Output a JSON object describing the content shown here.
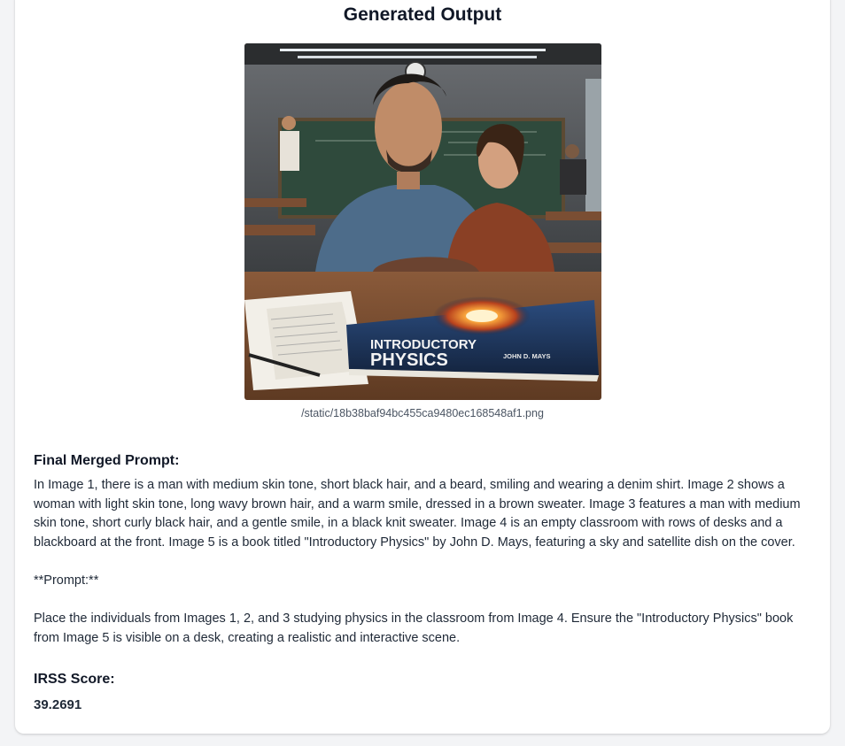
{
  "header": {
    "title": "Generated Output"
  },
  "output_image": {
    "caption": "/static/18b38baf94bc455ca9480ec168548af1.png",
    "book_title_line1": "INTRODUCTORY",
    "book_title_line2": "PHYSICS",
    "book_author": "JOHN D. MAYS"
  },
  "prompt_section": {
    "heading": "Final Merged Prompt:",
    "description": "In Image 1, there is a man with medium skin tone, short black hair, and a beard, smiling and wearing a denim shirt. Image 2 shows a woman with light skin tone, long wavy brown hair, and a warm smile, dressed in a brown sweater. Image 3 features a man with medium skin tone, short curly black hair, and a gentle smile, in a black knit sweater. Image 4 is an empty classroom with rows of desks and a blackboard at the front. Image 5 is a book titled \"Introductory Physics\" by John D. Mays, featuring a sky and satellite dish on the cover.",
    "prompt_marker": "**Prompt:**",
    "prompt_text": "Place the individuals from Images 1, 2, and 3 studying physics in the classroom from Image 4. Ensure the \"Introductory Physics\" book from Image 5 is visible on a desk, creating a realistic and interactive scene."
  },
  "score_section": {
    "heading": "IRSS Score:",
    "value": "39.2691"
  }
}
